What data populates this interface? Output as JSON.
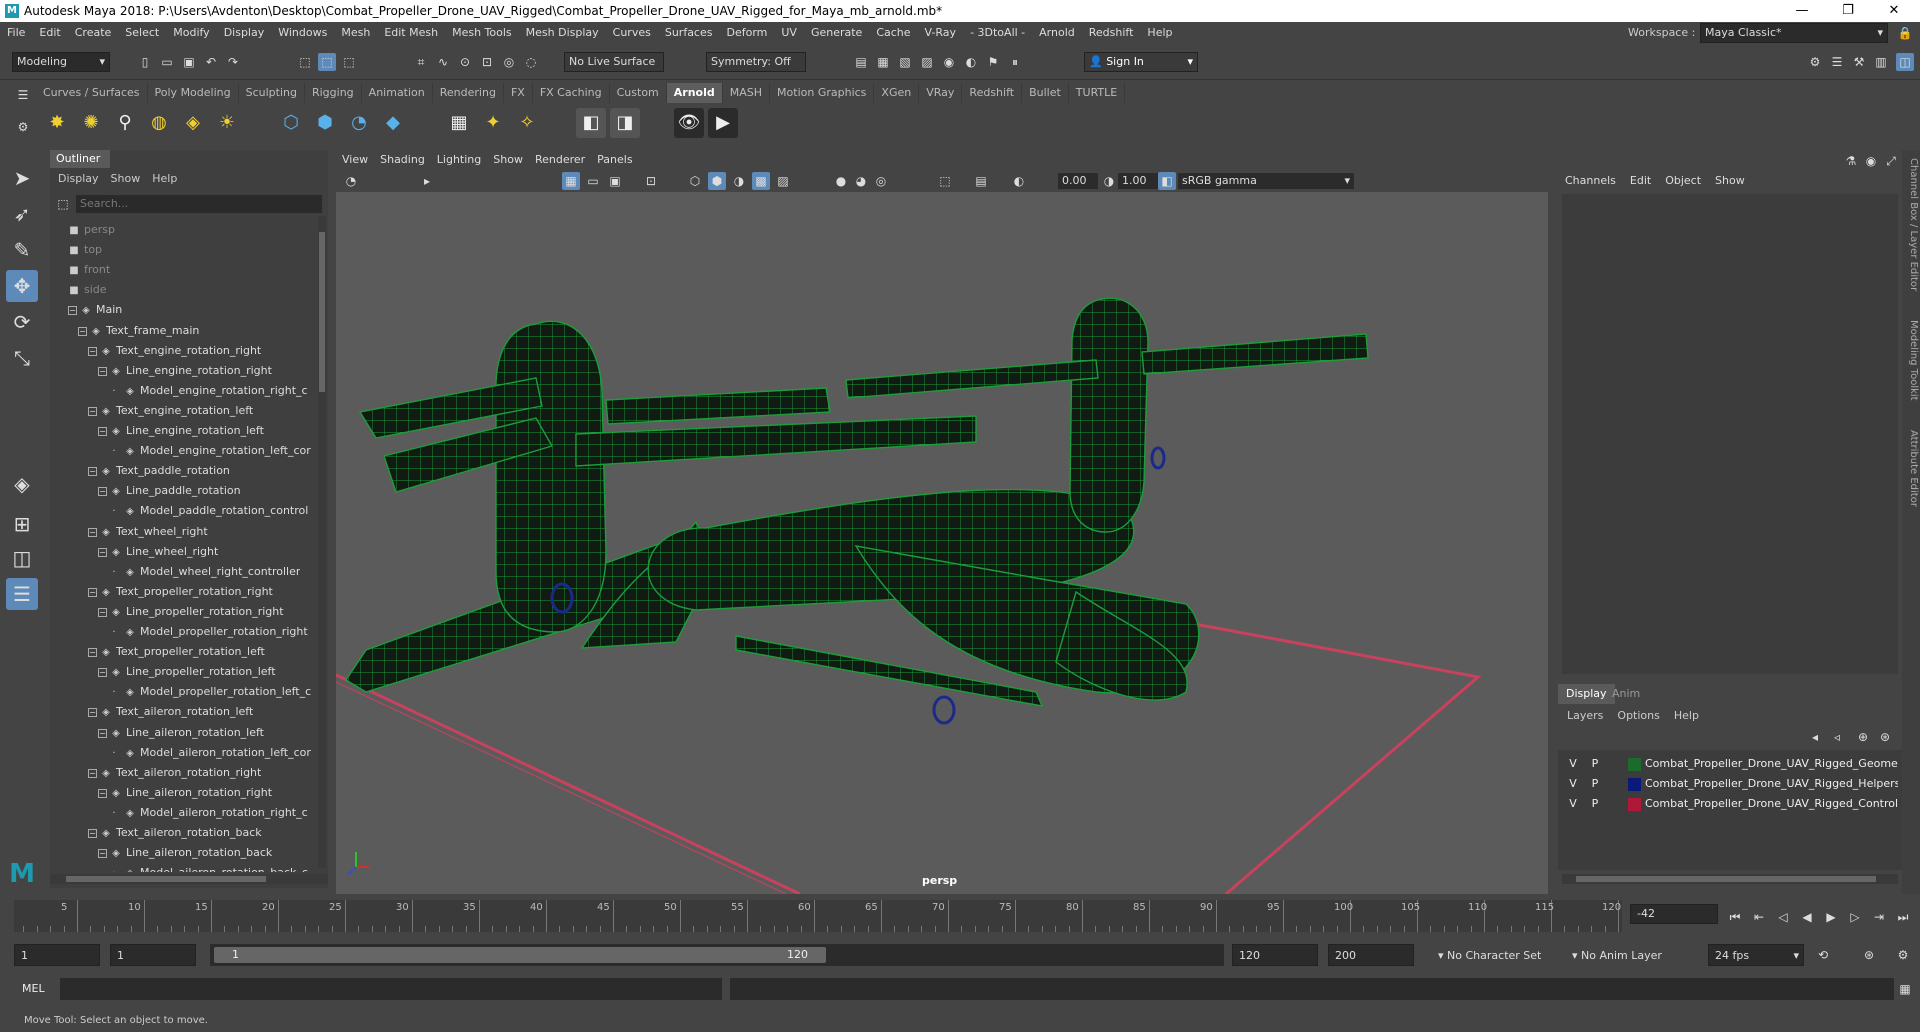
{
  "window": {
    "title": "Autodesk Maya 2018: P:\\Users\\Avdenton\\Desktop\\Combat_Propeller_Drone_UAV_Rigged\\Combat_Propeller_Drone_UAV_Rigged_for_Maya_mb_arnold.mb*",
    "minimize": "—",
    "restore": "❐",
    "close": "✕"
  },
  "menu": [
    "File",
    "Edit",
    "Create",
    "Select",
    "Modify",
    "Display",
    "Windows",
    "Mesh",
    "Edit Mesh",
    "Mesh Tools",
    "Mesh Display",
    "Curves",
    "Surfaces",
    "Deform",
    "UV",
    "Generate",
    "Cache",
    "V-Ray",
    "- 3DtoAll -",
    "Arnold",
    "Redshift",
    "Help"
  ],
  "workspace": {
    "label": "Workspace :",
    "value": "Maya Classic*"
  },
  "toolbar": {
    "mode": "Modeling",
    "live_surface": "No Live Surface",
    "symmetry": "Symmetry: Off",
    "sign_in": "Sign In"
  },
  "shelf_tabs": [
    "Curves / Surfaces",
    "Poly Modeling",
    "Sculpting",
    "Rigging",
    "Animation",
    "Rendering",
    "FX",
    "FX Caching",
    "Custom",
    "Arnold",
    "MASH",
    "Motion Graphics",
    "XGen",
    "VRay",
    "Redshift",
    "Bullet",
    "TURTLE"
  ],
  "shelf_active": "Arnold",
  "outliner": {
    "tab": "Outliner",
    "menu": [
      "Display",
      "Show",
      "Help"
    ],
    "search_placeholder": "Search...",
    "rows": [
      {
        "label": "persp",
        "depth": 0,
        "type": "camera",
        "dim": true
      },
      {
        "label": "top",
        "depth": 0,
        "type": "camera",
        "dim": true
      },
      {
        "label": "front",
        "depth": 0,
        "type": "camera",
        "dim": true
      },
      {
        "label": "side",
        "depth": 0,
        "type": "camera",
        "dim": true
      },
      {
        "label": "Main",
        "depth": 0,
        "type": "group"
      },
      {
        "label": "Text_frame_main",
        "depth": 1,
        "type": "group"
      },
      {
        "label": "Text_engine_rotation_right",
        "depth": 2,
        "type": "group"
      },
      {
        "label": "Line_engine_rotation_right",
        "depth": 3,
        "type": "group"
      },
      {
        "label": "Model_engine_rotation_right_c",
        "depth": 4,
        "type": "leaf"
      },
      {
        "label": "Text_engine_rotation_left",
        "depth": 2,
        "type": "group"
      },
      {
        "label": "Line_engine_rotation_left",
        "depth": 3,
        "type": "group"
      },
      {
        "label": "Model_engine_rotation_left_cor",
        "depth": 4,
        "type": "leaf"
      },
      {
        "label": "Text_paddle_rotation",
        "depth": 2,
        "type": "group"
      },
      {
        "label": "Line_paddle_rotation",
        "depth": 3,
        "type": "group"
      },
      {
        "label": "Model_paddle_rotation_control",
        "depth": 4,
        "type": "leaf"
      },
      {
        "label": "Text_wheel_right",
        "depth": 2,
        "type": "group"
      },
      {
        "label": "Line_wheel_right",
        "depth": 3,
        "type": "group"
      },
      {
        "label": "Model_wheel_right_controller",
        "depth": 4,
        "type": "leaf"
      },
      {
        "label": "Text_propeller_rotation_right",
        "depth": 2,
        "type": "group"
      },
      {
        "label": "Line_propeller_rotation_right",
        "depth": 3,
        "type": "group"
      },
      {
        "label": "Model_propeller_rotation_right",
        "depth": 4,
        "type": "leaf"
      },
      {
        "label": "Text_propeller_rotation_left",
        "depth": 2,
        "type": "group"
      },
      {
        "label": "Line_propeller_rotation_left",
        "depth": 3,
        "type": "group"
      },
      {
        "label": "Model_propeller_rotation_left_c",
        "depth": 4,
        "type": "leaf"
      },
      {
        "label": "Text_aileron_rotation_left",
        "depth": 2,
        "type": "group"
      },
      {
        "label": "Line_aileron_rotation_left",
        "depth": 3,
        "type": "group"
      },
      {
        "label": "Model_aileron_rotation_left_cor",
        "depth": 4,
        "type": "leaf"
      },
      {
        "label": "Text_aileron_rotation_right",
        "depth": 2,
        "type": "group"
      },
      {
        "label": "Line_aileron_rotation_right",
        "depth": 3,
        "type": "group"
      },
      {
        "label": "Model_aileron_rotation_right_c",
        "depth": 4,
        "type": "leaf"
      },
      {
        "label": "Text_aileron_rotation_back",
        "depth": 2,
        "type": "group"
      },
      {
        "label": "Line_aileron_rotation_back",
        "depth": 3,
        "type": "group"
      },
      {
        "label": "Model_aileron_rotation_back_c",
        "depth": 4,
        "type": "leaf"
      }
    ]
  },
  "viewport": {
    "menu": [
      "View",
      "Shading",
      "Lighting",
      "Show",
      "Renderer",
      "Panels"
    ],
    "exposure": "0.00",
    "gamma": "1.00",
    "color_space": "sRGB gamma",
    "camera_label": "persp",
    "wire_color": "#1b9e3a",
    "grid_color": "#c8425e"
  },
  "channel_box": {
    "menu": [
      "Channels",
      "Edit",
      "Object",
      "Show"
    ]
  },
  "layer_editor": {
    "tabs": [
      "Display",
      "Anim"
    ],
    "menu": [
      "Layers",
      "Options",
      "Help"
    ],
    "layers": [
      {
        "v": "V",
        "p": "P",
        "color": "#1a6b2c",
        "name": "Combat_Propeller_Drone_UAV_Rigged_Geometry"
      },
      {
        "v": "V",
        "p": "P",
        "color": "#0a1a7a",
        "name": "Combat_Propeller_Drone_UAV_Rigged_Helpers"
      },
      {
        "v": "V",
        "p": "P",
        "color": "#b0183a",
        "name": "Combat_Propeller_Drone_UAV_Rigged_Controllers"
      }
    ]
  },
  "right_strip": [
    "Channel Box / Layer Editor",
    "Modeling Toolkit",
    "Attribute Editor"
  ],
  "timeline": {
    "ticks": [
      5,
      10,
      15,
      20,
      25,
      30,
      35,
      40,
      45,
      50,
      55,
      60,
      65,
      70,
      75,
      80,
      85,
      90,
      95,
      100,
      105,
      110,
      115,
      120
    ],
    "current_frame": "-42"
  },
  "range": {
    "start": "1",
    "playback_start": "1",
    "slider_start": "1",
    "slider_end": "120",
    "playback_end": "120",
    "end": "200",
    "character_set": "No Character Set",
    "anim_layer": "No Anim Layer",
    "fps": "24 fps"
  },
  "mel": {
    "label": "MEL"
  },
  "status": {
    "text": "Move Tool: Select an object to move."
  }
}
